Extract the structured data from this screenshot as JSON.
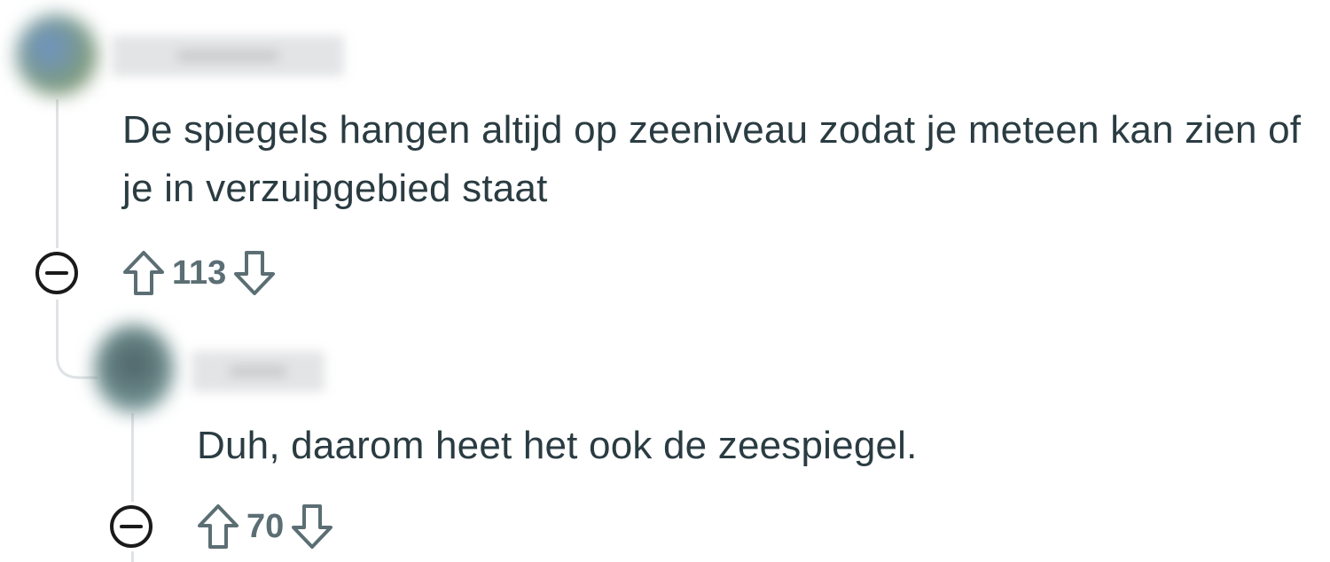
{
  "comments": [
    {
      "body": "De spiegels hangen altijd op zeeniveau zodat je meteen kan zien of je in verzuipgebied staat",
      "score": "113",
      "icons": {
        "collapse": "minus-circle-icon",
        "upvote": "arrow-up-outline-icon",
        "downvote": "arrow-down-outline-icon"
      }
    },
    {
      "body": "Duh, daarom heet het ook de zeespiegel.",
      "score": "70",
      "icons": {
        "collapse": "minus-circle-icon",
        "upvote": "arrow-up-outline-icon",
        "downvote": "arrow-down-outline-icon"
      }
    }
  ],
  "colors": {
    "text": "#2a3c42",
    "meta": "#5b6e74",
    "thread_line": "#dfe3e6",
    "icon": "#1a1a1b"
  }
}
